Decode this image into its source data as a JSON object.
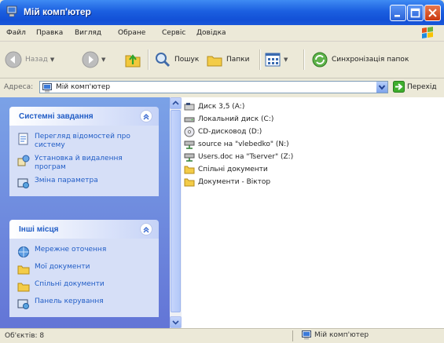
{
  "window": {
    "title": "Мій комп'ютер"
  },
  "menu": {
    "items": [
      "Файл",
      "Правка",
      "Вигляд",
      "Обране",
      "Сервіс",
      "Довідка"
    ]
  },
  "toolbar": {
    "back": "Назад",
    "search": "Пошук",
    "folders": "Папки",
    "sync": "Синхронізація папок"
  },
  "address": {
    "label": "Адреса:",
    "value": "Мій комп'ютер",
    "go": "Перехід"
  },
  "tasks": {
    "title": "Системні завдання",
    "items": [
      "Перегляд відомостей про систему",
      "Установка й видалення програм",
      "Зміна параметра"
    ]
  },
  "places": {
    "title": "Інші місця",
    "items": [
      "Мережне оточення",
      "Мої документи",
      "Спільні документи",
      "Панель керування"
    ]
  },
  "files": [
    {
      "label": "Диск 3,5 (A:)",
      "icon": "floppy-drive-icon"
    },
    {
      "label": "Локальний диск (C:)",
      "icon": "hard-disk-icon"
    },
    {
      "label": "CD-дисковод (D:)",
      "icon": "cd-drive-icon"
    },
    {
      "label": "source на \"vlebedko\" (N:)",
      "icon": "network-drive-icon"
    },
    {
      "label": "Users.doc на \"Tserver\" (Z:)",
      "icon": "network-drive-icon"
    },
    {
      "label": "Спільні документи",
      "icon": "folder-icon"
    },
    {
      "label": "Документи - Віктор",
      "icon": "folder-icon"
    }
  ],
  "status": {
    "left": "Об'єктів: 8",
    "right": "Мій комп'ютер"
  }
}
